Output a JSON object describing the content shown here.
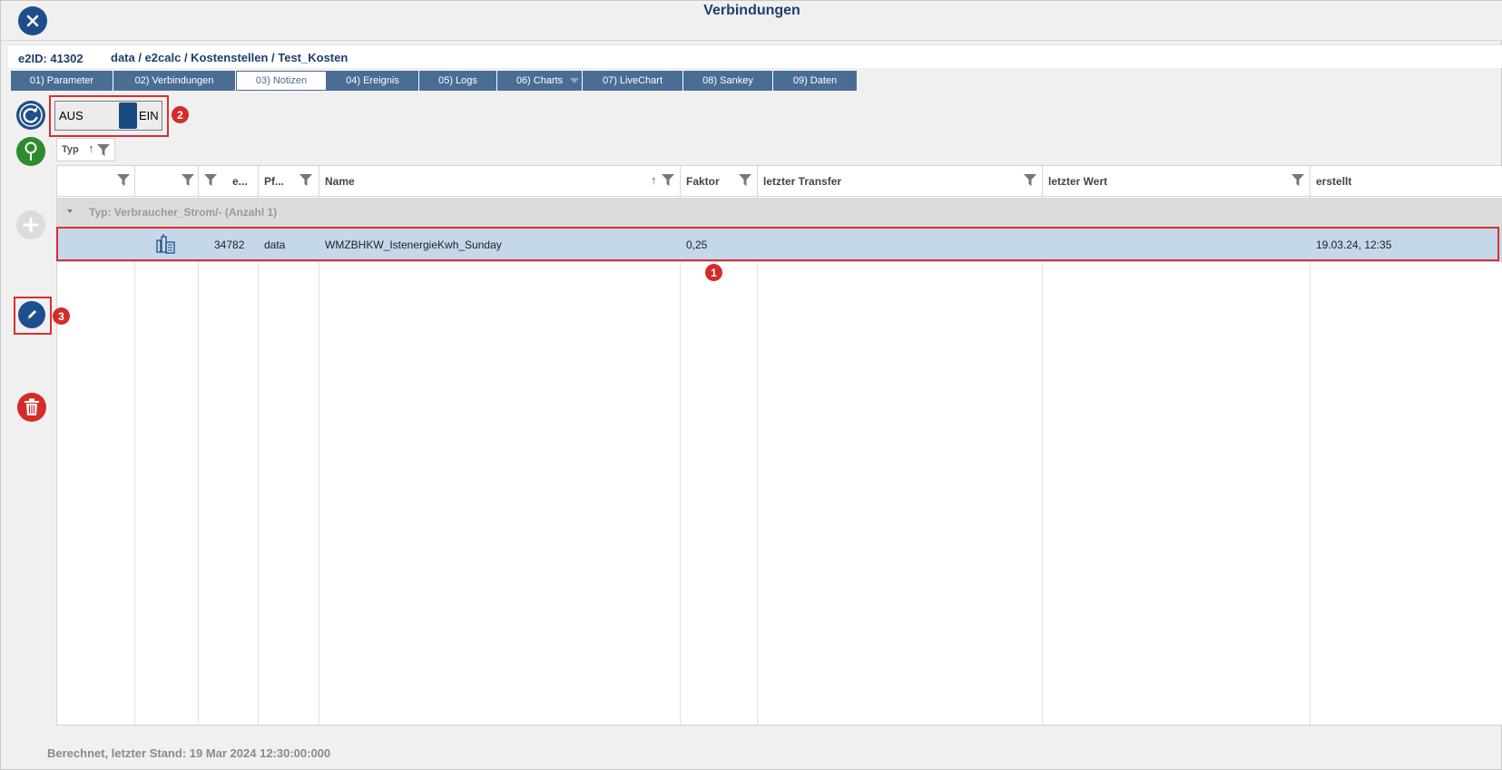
{
  "window": {
    "title": "Verbindungen"
  },
  "breadcrumb": {
    "e2id": "e2ID: 41302",
    "path": "data / e2calc / Kostenstellen / Test_Kosten"
  },
  "tabs": [
    {
      "label": "01) Parameter"
    },
    {
      "label": "02) Verbindungen"
    },
    {
      "label": "03) Notizen",
      "active": true
    },
    {
      "label": "04) Ereignis"
    },
    {
      "label": "05) Logs"
    },
    {
      "label": "06) Charts"
    },
    {
      "label": "07) LiveChart"
    },
    {
      "label": "08) Sankey"
    },
    {
      "label": "09) Daten"
    }
  ],
  "toggle": {
    "off_label": "AUS",
    "on_label": "EIN",
    "state": "EIN"
  },
  "grouping": {
    "label": "Typ"
  },
  "grid": {
    "columns": [
      "",
      "",
      "e...",
      "Pf...",
      "Name",
      "Faktor",
      "letzter Transfer",
      "letzter Wert",
      "erstellt"
    ],
    "group": {
      "label": "Typ: Verbraucher_Strom/- (Anzahl 1)"
    },
    "rows": [
      {
        "icon": "meter-icon",
        "id": "34782",
        "pfad": "data",
        "name": "WMZBHKW_IstenergieKwh_Sunday",
        "faktor": "0,25",
        "letzter_transfer": "",
        "letzter_wert": "",
        "erstellt": "19.03.24, 12:35"
      }
    ]
  },
  "annotations": [
    "1",
    "2",
    "3"
  ],
  "status": {
    "text": "Berechnet, letzter Stand: 19 Mar 2024 12:30:00:000"
  },
  "colors": {
    "primary": "#1f4e8c",
    "tab": "#4a6d94",
    "selected_row": "#c5d8ea",
    "add_button": "#2e8b2e",
    "delete_button": "#d42b2b",
    "highlight": "#d83030"
  }
}
